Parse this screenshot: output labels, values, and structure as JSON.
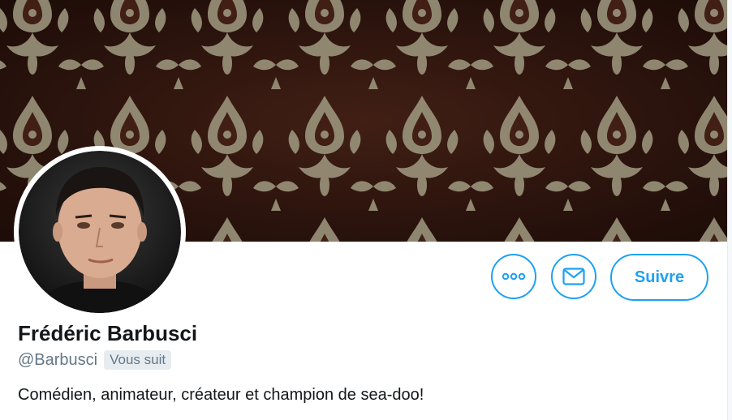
{
  "profile": {
    "display_name": "Frédéric Barbusci",
    "handle": "@Barbusci",
    "follows_you_badge": "Vous suit",
    "bio": "Comédien, animateur, créateur et champion de sea-doo!"
  },
  "actions": {
    "more_icon": "more-horizontal-icon",
    "message_icon": "envelope-icon",
    "follow_label": "Suivre"
  },
  "colors": {
    "accent": "#1da1f2",
    "banner_background": "#3a1a14",
    "banner_pattern": "#b8b094",
    "secondary_text": "#657786",
    "primary_text": "#14171a"
  }
}
